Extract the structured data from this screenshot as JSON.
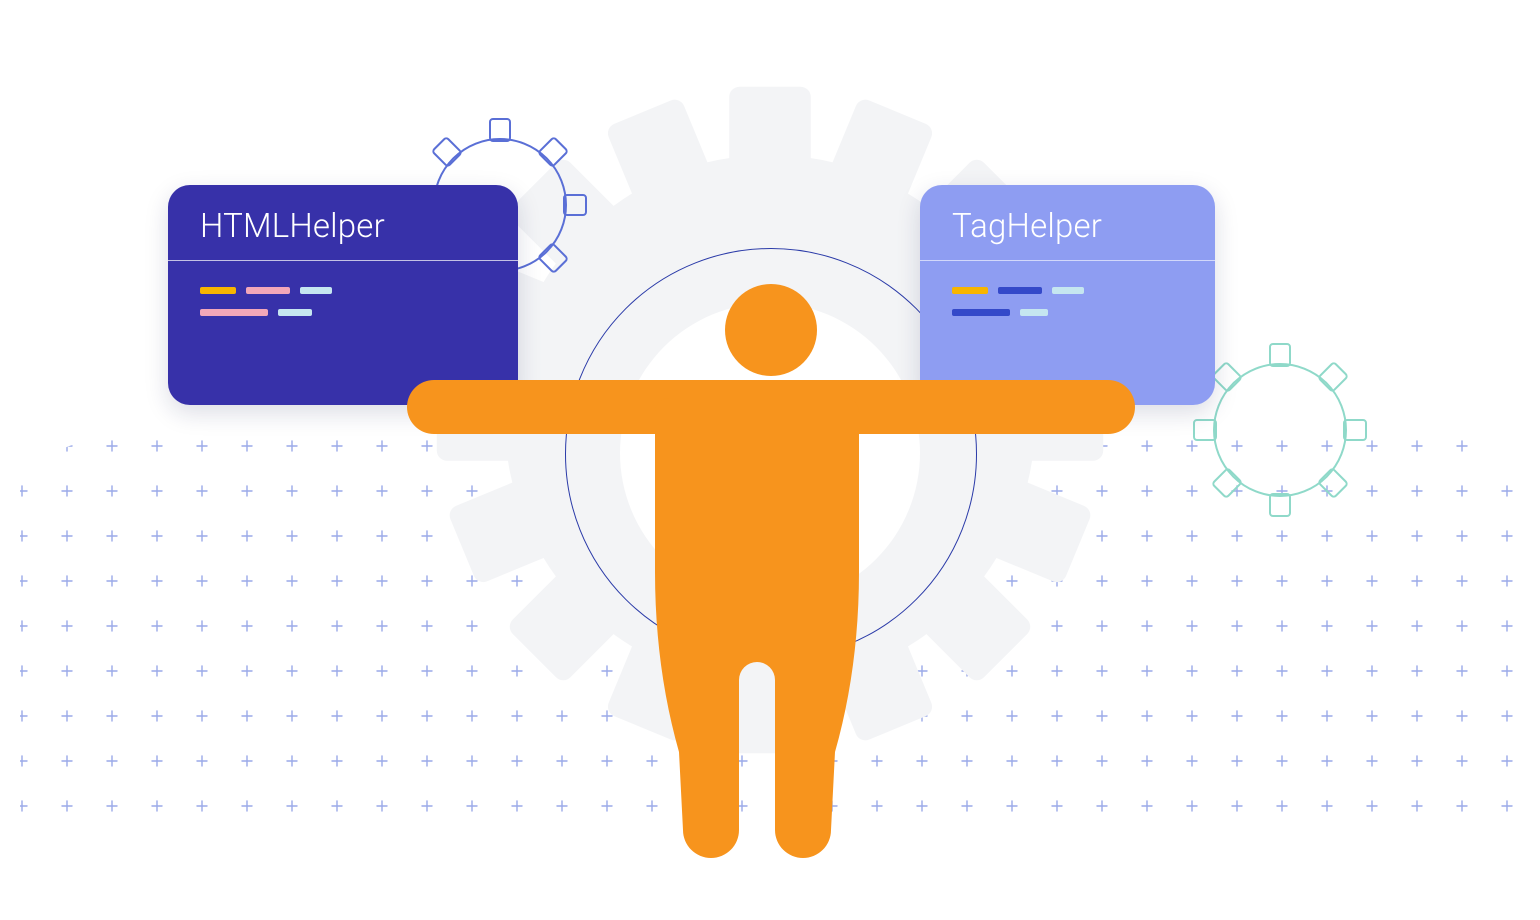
{
  "cards": {
    "left": {
      "title": "HTMLHelper"
    },
    "right": {
      "title": "TagHelper"
    }
  },
  "colors": {
    "card_left_bg": "#3731a9",
    "card_right_bg": "#8e9df2",
    "accent_orange": "#f7941d",
    "gear_fill": "#f3f4f6",
    "gear_outline_blue": "#5a6fd6",
    "gear_outline_teal": "#7ad3c0",
    "grid_plus": "#9aa9e8"
  },
  "icons": {
    "person": "accessibility-person-icon",
    "gear_large": "gear-large-icon",
    "gear_small_blue": "gear-outline-blue-icon",
    "gear_small_teal": "gear-outline-teal-icon"
  }
}
